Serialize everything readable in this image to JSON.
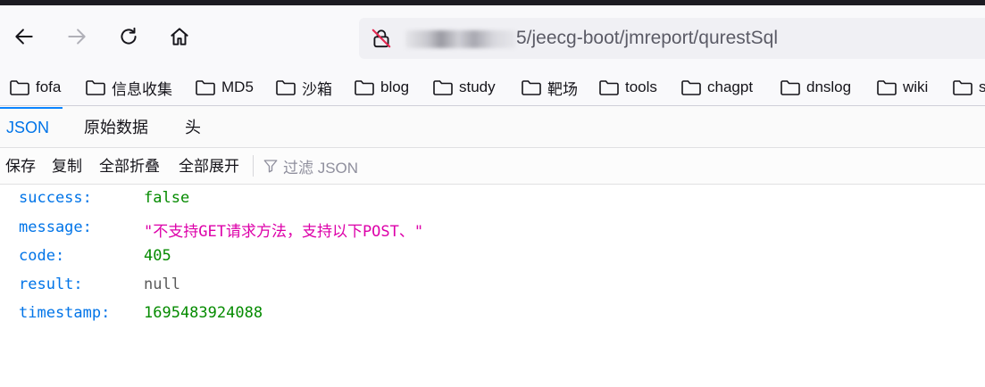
{
  "browser": {
    "url_visible": "5/jeecg-boot/jmreport/qurestSql",
    "icons": {
      "back": "back-arrow-icon",
      "forward": "forward-arrow-icon",
      "reload": "reload-icon",
      "home": "home-icon",
      "security": "insecure-lock-icon"
    }
  },
  "bookmarks": [
    {
      "label": "fofa"
    },
    {
      "label": "信息收集"
    },
    {
      "label": "MD5"
    },
    {
      "label": "沙箱"
    },
    {
      "label": "blog"
    },
    {
      "label": "study"
    },
    {
      "label": "靶场"
    },
    {
      "label": "tools"
    },
    {
      "label": "chagpt"
    },
    {
      "label": "dnslog"
    },
    {
      "label": "wiki"
    },
    {
      "label": "s"
    }
  ],
  "viewer": {
    "tabs": [
      {
        "label": "JSON",
        "active": true
      },
      {
        "label": "原始数据",
        "active": false
      },
      {
        "label": "头",
        "active": false
      }
    ],
    "toolbar": {
      "save": "保存",
      "copy": "复制",
      "collapse_all": "全部折叠",
      "expand_all": "全部展开",
      "filter_placeholder": "过滤 JSON"
    },
    "rows": [
      {
        "key": "success:",
        "value": "false",
        "type": "bool"
      },
      {
        "key": "message:",
        "value": "\"不支持GET请求方法，支持以下POST、\"",
        "type": "str"
      },
      {
        "key": "code:",
        "value": "405",
        "type": "num"
      },
      {
        "key": "result:",
        "value": "null",
        "type": "null"
      },
      {
        "key": "timestamp:",
        "value": "1695483924088",
        "type": "num"
      }
    ]
  },
  "colors": {
    "accent": "#0074e8",
    "key": "#0074e8",
    "string": "#dd00a9",
    "number": "#058b00",
    "null": "#5a5a5a"
  }
}
